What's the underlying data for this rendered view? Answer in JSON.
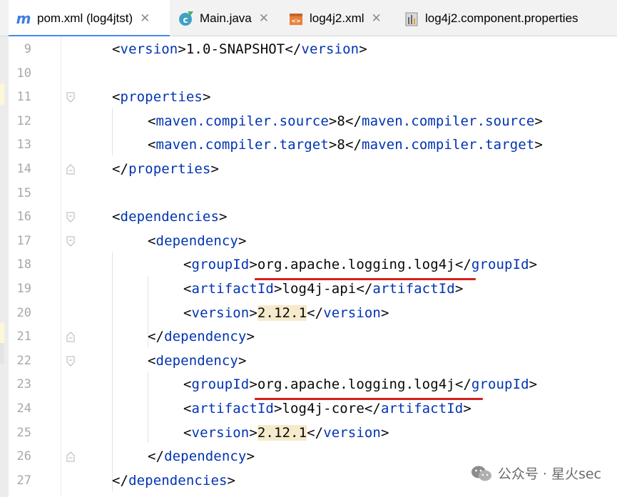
{
  "tabs": [
    {
      "label": "pom.xml (log4jtst)",
      "icon": "maven-icon",
      "active": true
    },
    {
      "label": "Main.java",
      "icon": "java-class-icon",
      "active": false
    },
    {
      "label": "log4j2.xml",
      "icon": "xml-file-icon",
      "active": false
    },
    {
      "label": "log4j2.component.properties",
      "icon": "properties-file-icon",
      "active": false
    }
  ],
  "colors": {
    "tag": "#0033b3",
    "text": "#080808",
    "line_number": "#a8a8a8",
    "highlight": "#f5eacb",
    "underline": "#d81e1e",
    "active_tab_accent": "#4a88f0"
  },
  "code_lines": [
    {
      "num": "9",
      "open": "<",
      "tag": "version",
      "close": ">",
      "value": "1.0-SNAPSHOT",
      "end_open": "</",
      "end_tag": "version",
      "end_close": ">"
    },
    {
      "num": "10"
    },
    {
      "num": "11",
      "open": "<",
      "tag": "properties",
      "close": ">"
    },
    {
      "num": "12",
      "open": "<",
      "tag": "maven.compiler.source",
      "close": ">",
      "value": "8",
      "end_open": "</",
      "end_tag": "maven.compiler.source",
      "end_close": ">"
    },
    {
      "num": "13",
      "open": "<",
      "tag": "maven.compiler.target",
      "close": ">",
      "value": "8",
      "end_open": "</",
      "end_tag": "maven.compiler.target",
      "end_close": ">"
    },
    {
      "num": "14",
      "open": "</",
      "tag": "properties",
      "close": ">"
    },
    {
      "num": "15"
    },
    {
      "num": "16",
      "open": "<",
      "tag": "dependencies",
      "close": ">"
    },
    {
      "num": "17",
      "open": "<",
      "tag": "dependency",
      "close": ">"
    },
    {
      "num": "18",
      "open": "<",
      "tag": "groupId",
      "close": ">",
      "value": "org.apache.logging.log4j",
      "end_open": "</",
      "end_tag": "groupId",
      "end_close": ">"
    },
    {
      "num": "19",
      "open": "<",
      "tag": "artifactId",
      "close": ">",
      "value": "log4j-api",
      "end_open": "</",
      "end_tag": "artifactId",
      "end_close": ">"
    },
    {
      "num": "20",
      "open": "<",
      "tag": "version",
      "close": ">",
      "value": "2.12.1",
      "end_open": "</",
      "end_tag": "version",
      "end_close": ">"
    },
    {
      "num": "21",
      "open": "</",
      "tag": "dependency",
      "close": ">"
    },
    {
      "num": "22",
      "open": "<",
      "tag": "dependency",
      "close": ">"
    },
    {
      "num": "23",
      "open": "<",
      "tag": "groupId",
      "close": ">",
      "value": "org.apache.logging.log4j",
      "end_open": "</",
      "end_tag": "groupId",
      "end_close": ">"
    },
    {
      "num": "24",
      "open": "<",
      "tag": "artifactId",
      "close": ">",
      "value": "log4j-core",
      "end_open": "</",
      "end_tag": "artifactId",
      "end_close": ">"
    },
    {
      "num": "25",
      "open": "<",
      "tag": "version",
      "close": ">",
      "value": "2.12.1",
      "end_open": "</",
      "end_tag": "version",
      "end_close": ">"
    },
    {
      "num": "26",
      "open": "</",
      "tag": "dependency",
      "close": ">"
    },
    {
      "num": "27",
      "open": "</",
      "tag": "dependencies",
      "close": ">"
    }
  ],
  "watermark": {
    "text": "公众号 · 星火sec",
    "icon": "wechat-icon"
  }
}
